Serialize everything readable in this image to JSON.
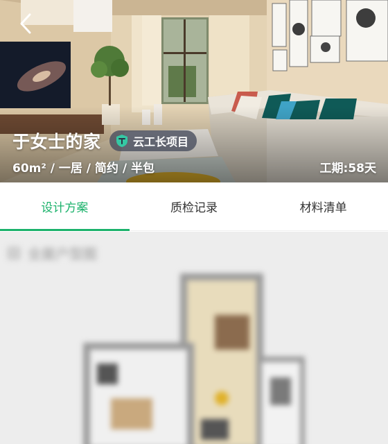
{
  "header": {
    "home_title": "于女士的家",
    "badge_label": "云工长项目",
    "specs": "60m² / 一居 / 简约 / 半包",
    "duration": "工期:58天"
  },
  "tabs": [
    {
      "label": "设计方案",
      "active": true
    },
    {
      "label": "质检记录",
      "active": false
    },
    {
      "label": "材料清单",
      "active": false
    }
  ],
  "content": {
    "section_title": "全屋户型图"
  },
  "colors": {
    "accent": "#1bb26b",
    "badge_bg": "#464b5c",
    "badge_icon": "#35c8a4"
  }
}
